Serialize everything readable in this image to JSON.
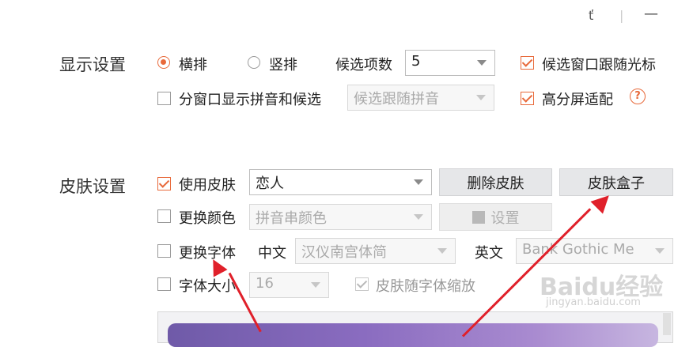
{
  "window": {
    "minimize_label": "—",
    "separator": "|",
    "pin_label": "ť"
  },
  "display": {
    "title": "显示设置",
    "horizontal": "横排",
    "vertical": "竖排",
    "candidates_label": "候选项数",
    "candidates_value": "5",
    "follow_cursor": "候选窗口跟随光标",
    "split_window": "分窗口显示拼音和候选",
    "split_mode_value": "候选跟随拼音",
    "high_dpi": "高分屏适配",
    "help_icon": "?"
  },
  "skin": {
    "title": "皮肤设置",
    "use_skin": "使用皮肤",
    "skin_value": "恋人",
    "delete_skin": "删除皮肤",
    "skin_box": "皮肤盒子",
    "change_color": "更换颜色",
    "color_value": "拼音串颜色",
    "settings": "设置",
    "change_font": "更换字体",
    "chinese_label": "中文",
    "chinese_font": "汉仪南宫体简",
    "english_label": "英文",
    "english_font": "Bank Gothic Me",
    "font_size_label": "字体大小",
    "font_size_value": "16",
    "skin_follow_font": "皮肤随字体缩放"
  },
  "watermark": {
    "brand": "Baidu经验",
    "url": "jingyan.baidu.com"
  },
  "colors": {
    "accent": "#e8693a",
    "annotation_arrow": "#e0202a"
  }
}
